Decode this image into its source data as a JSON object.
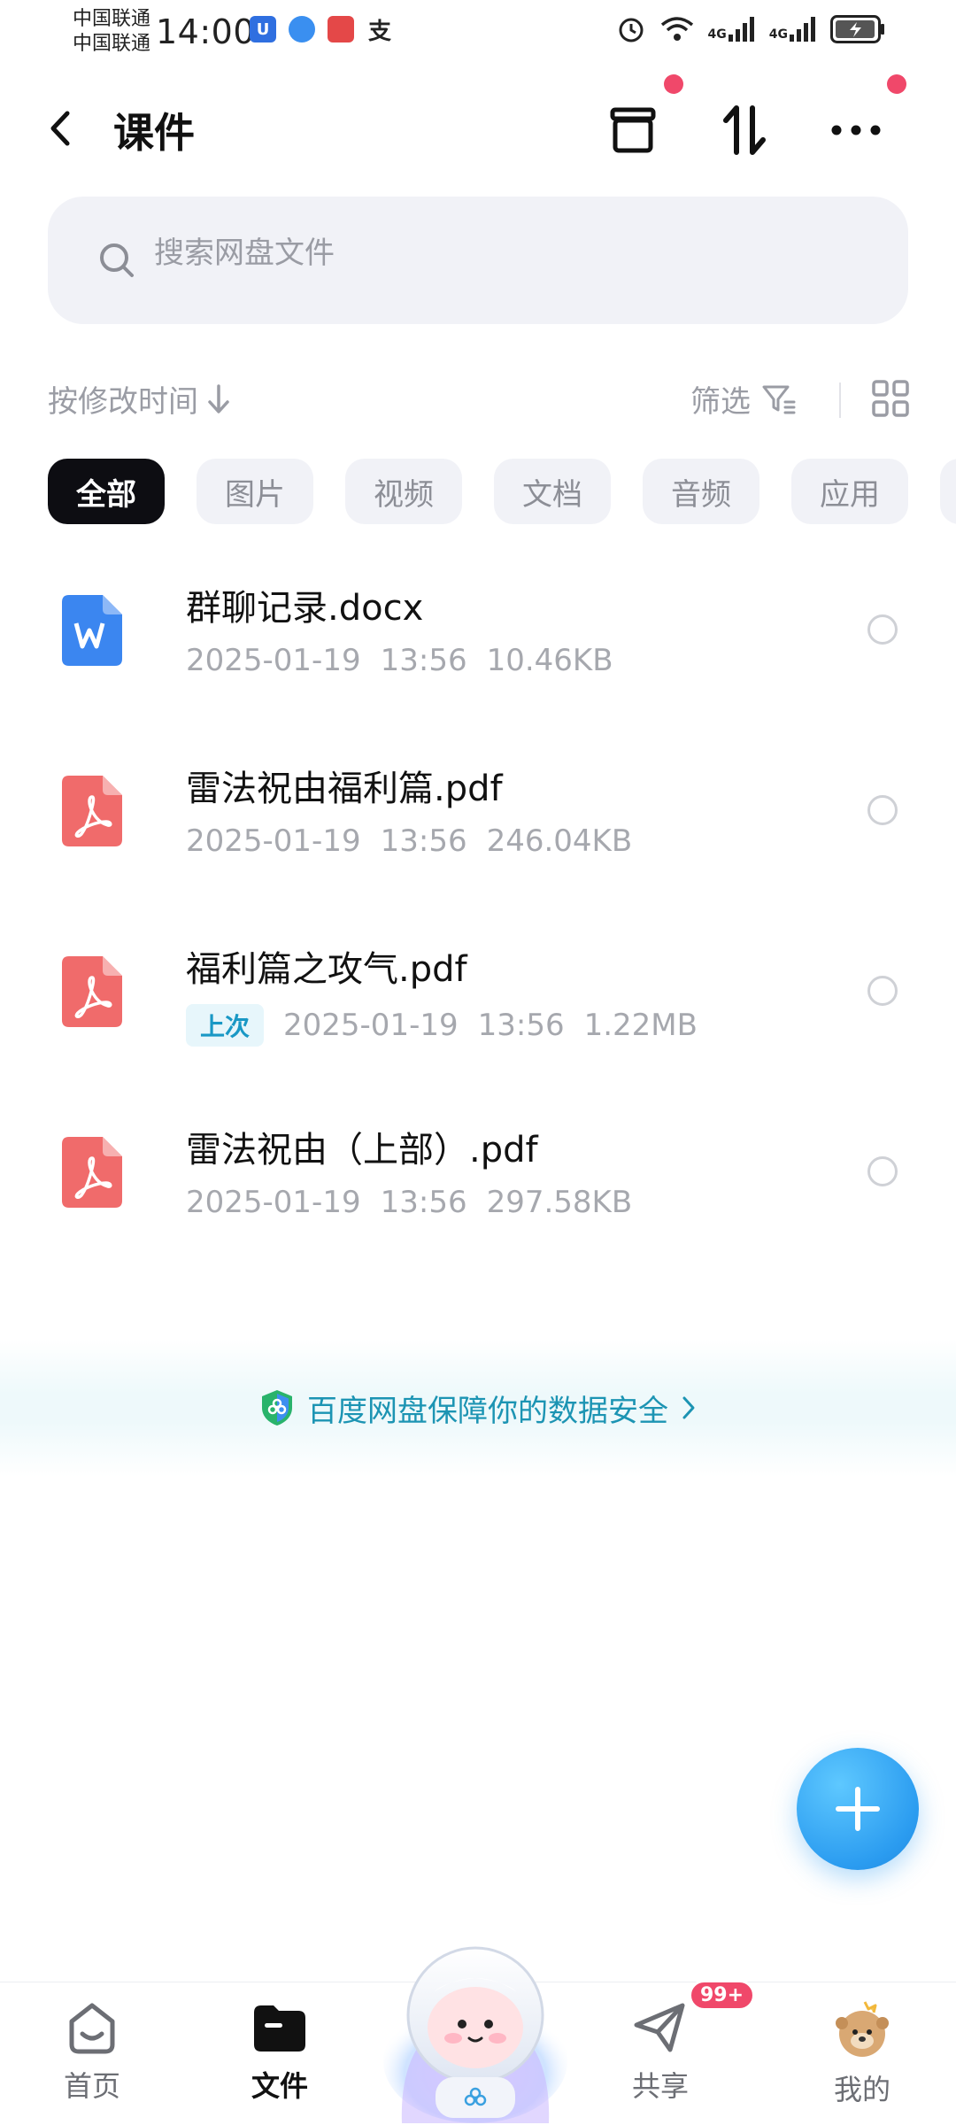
{
  "status_bar": {
    "carrier1": "中国联通",
    "carrier2": "中国联通",
    "time": "14:00",
    "network1": "4G",
    "network2": "4G"
  },
  "header": {
    "title": "课件"
  },
  "search": {
    "placeholder": "搜索网盘文件"
  },
  "sort": {
    "label": "按修改时间",
    "filter_label": "筛选"
  },
  "chips": [
    {
      "label": "全部",
      "active": true
    },
    {
      "label": "图片",
      "active": false
    },
    {
      "label": "视频",
      "active": false
    },
    {
      "label": "文档",
      "active": false
    },
    {
      "label": "音频",
      "active": false
    },
    {
      "label": "应用",
      "active": false
    }
  ],
  "files": [
    {
      "name": "群聊记录.docx",
      "type": "word-icon",
      "badge": "",
      "date": "2025-01-19",
      "time": "13:56",
      "size": "10.46KB"
    },
    {
      "name": "雷法祝由福利篇.pdf",
      "type": "pdf-icon",
      "badge": "",
      "date": "2025-01-19",
      "time": "13:56",
      "size": "246.04KB"
    },
    {
      "name": "福利篇之攻气.pdf",
      "type": "pdf-icon",
      "badge": "上次",
      "date": "2025-01-19",
      "time": "13:56",
      "size": "1.22MB"
    },
    {
      "name": "雷法祝由（上部）.pdf",
      "type": "pdf-icon",
      "badge": "",
      "date": "2025-01-19",
      "time": "13:56",
      "size": "297.58KB"
    }
  ],
  "security": {
    "text": "百度网盘保障你的数据安全"
  },
  "nav": {
    "home": "首页",
    "files": "文件",
    "share": "共享",
    "share_badge": "99+",
    "mine": "我的"
  },
  "colors": {
    "accent": "#2b9cf0",
    "pdf": "#f06b6b",
    "word": "#3b86f0",
    "dot": "#f0486a",
    "security": "#1c94b3"
  }
}
